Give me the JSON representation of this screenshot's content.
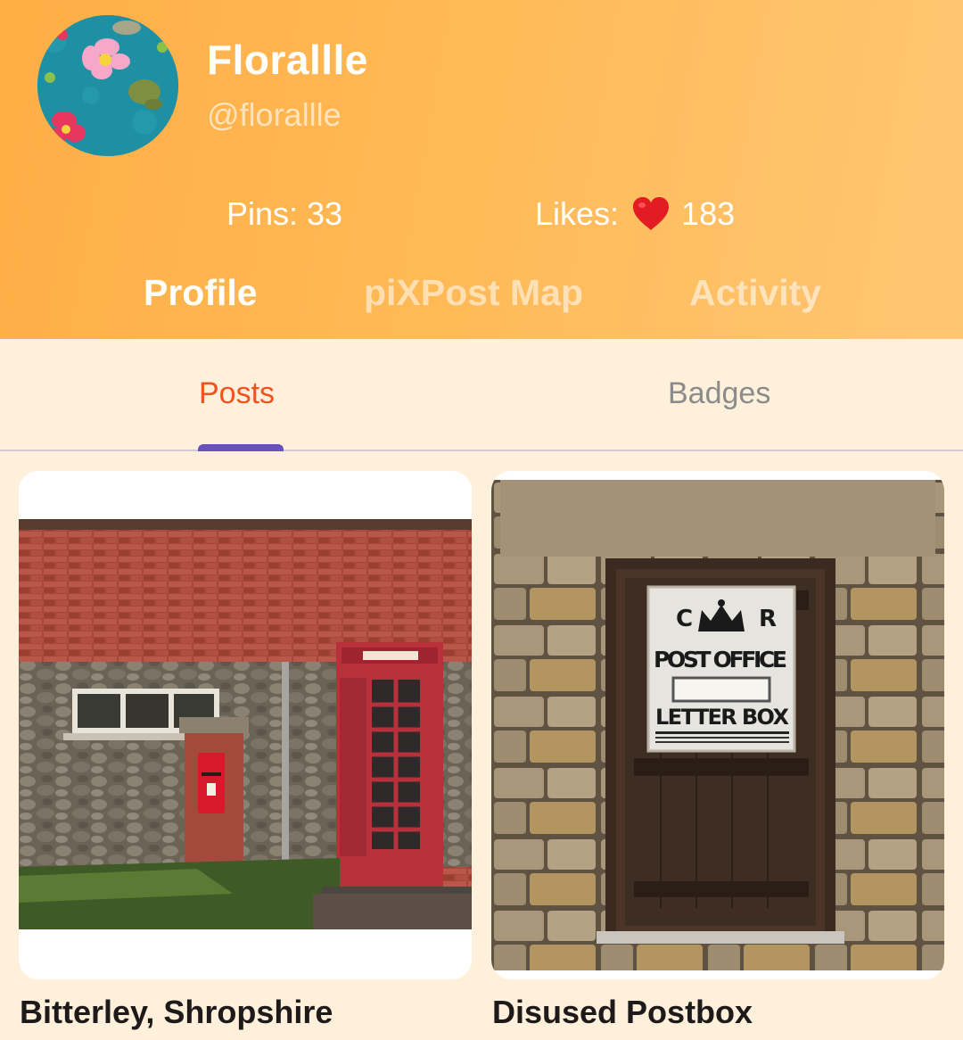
{
  "profile": {
    "display_name": "Florallle",
    "handle": "@florallle",
    "avatar_icon": "knitted-flowers-avatar"
  },
  "stats": {
    "pins_label": "Pins: 33",
    "likes_label": "Likes:",
    "likes_icon": "heart-icon",
    "likes_count": "183"
  },
  "main_tabs": [
    {
      "label": "Profile",
      "active": true
    },
    {
      "label": "piXPost Map",
      "active": false
    },
    {
      "label": "Activity",
      "active": false
    }
  ],
  "sub_tabs": [
    {
      "label": "Posts",
      "active": true
    },
    {
      "label": "Badges",
      "active": false
    }
  ],
  "posts": [
    {
      "title": "Bitterley, Shropshire",
      "image": "phone-box-and-postbox-photo"
    },
    {
      "title": "Disused Postbox",
      "image": "post-office-letter-box-door-photo"
    }
  ],
  "colors": {
    "header_start": "#ffae45",
    "header_end": "#ffc673",
    "background": "#fff0dc",
    "active_subtab": "#f0541e",
    "indicator": "#6a4fbe",
    "inactive_text": "#8b8b8b"
  }
}
